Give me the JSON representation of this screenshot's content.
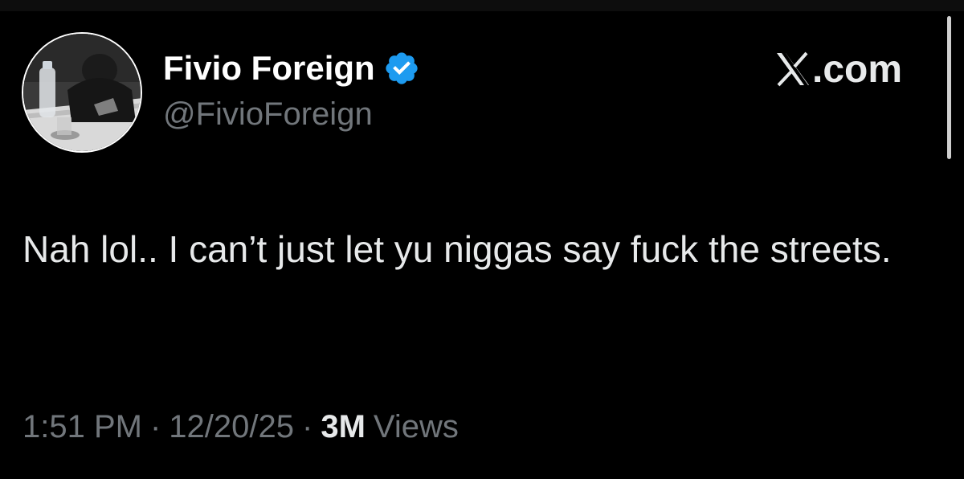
{
  "tweet": {
    "author": {
      "display_name": "Fivio Foreign",
      "handle": "@FivioForeign",
      "verified": true,
      "verified_icon": "verified-badge-icon",
      "verified_color": "#1d9bf0",
      "avatar_icon": "profile-photo"
    },
    "brand": {
      "icon": "x-logo-icon",
      "suffix": ".com"
    },
    "text": "Nah lol.. I can’t just let yu niggas say fuck the streets.",
    "meta": {
      "time": "1:51 PM",
      "separator": "·",
      "date": "12/20/25",
      "views_count": "3M",
      "views_label": "Views"
    }
  },
  "colors": {
    "background": "#000000",
    "primary_text": "#e7e9ea",
    "secondary_text": "#71767b"
  }
}
